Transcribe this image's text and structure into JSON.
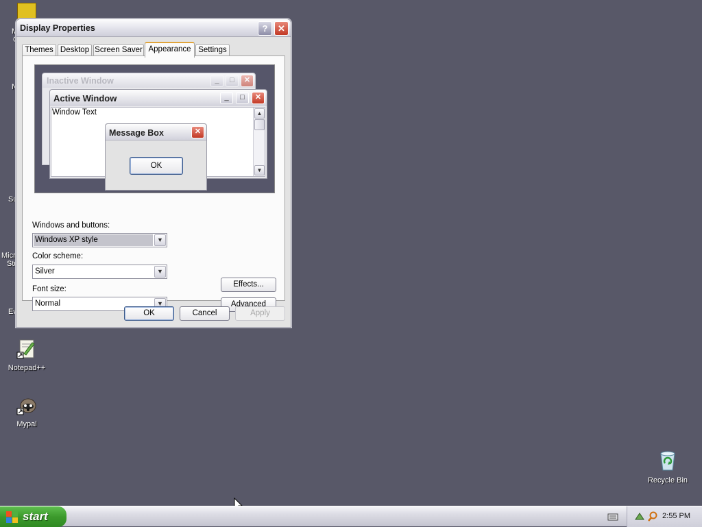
{
  "desktop": {
    "icons": [
      {
        "label": "Notepad++",
        "icon": "notepadpp-icon"
      },
      {
        "label": "Mypal",
        "icon": "mypal-icon"
      },
      {
        "label": "Recycle Bin",
        "icon": "recycle-bin-icon"
      }
    ],
    "partial_labels": [
      "M",
      "C",
      "N",
      "Su",
      "Micro",
      "Stu",
      "Ev"
    ]
  },
  "dialog": {
    "title": "Display Properties",
    "help_label": "?",
    "close_label": "✕",
    "tabs": [
      "Themes",
      "Desktop",
      "Screen Saver",
      "Appearance",
      "Settings"
    ],
    "active_tab": "Appearance",
    "preview": {
      "inactive_title": "Inactive Window",
      "active_title": "Active Window",
      "window_text": "Window Text",
      "message_box_title": "Message Box",
      "message_box_ok": "OK"
    },
    "windows_buttons_label": "Windows and buttons:",
    "windows_buttons_value": "Windows XP style",
    "color_scheme_label": "Color scheme:",
    "color_scheme_value": "Silver",
    "font_size_label": "Font size:",
    "font_size_value": "Normal",
    "effects_label": "Effects...",
    "advanced_label": "Advanced",
    "ok_label": "OK",
    "cancel_label": "Cancel",
    "apply_label": "Apply"
  },
  "taskbar": {
    "start_label": "start",
    "clock": "2:55 PM"
  },
  "colors": {
    "desktop": "#585868",
    "start_green": "#3c9a2c",
    "close_red": "#c23a26",
    "active_tab_accent": "#e0a43a"
  }
}
